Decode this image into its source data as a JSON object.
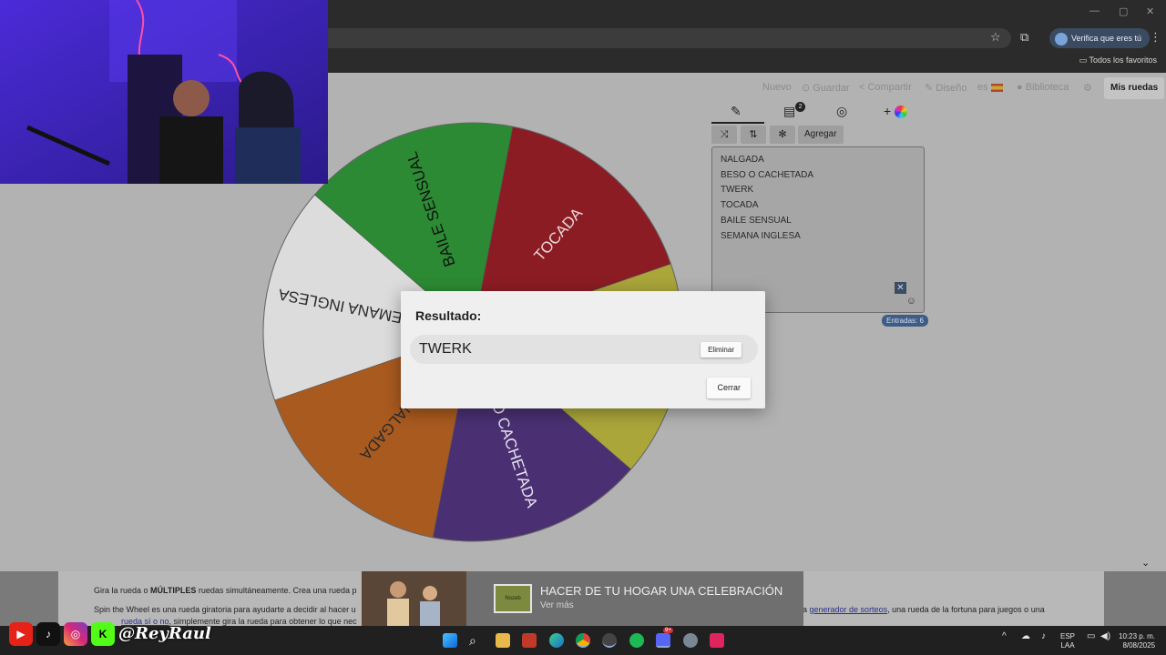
{
  "browser": {
    "verify_label": "Verifica que eres tú",
    "favorites_label": "Todos los favoritos",
    "window_controls": [
      "—",
      "▢",
      "✕"
    ]
  },
  "nav": {
    "items": [
      "Nuevo",
      "Guardar",
      "Compartir",
      "Diseño",
      "es",
      "Biblioteca"
    ],
    "my_wheels": "Mis ruedas"
  },
  "wheel": {
    "segments": [
      {
        "label": "TOCADA",
        "color": "#8b1c24",
        "text_color": "#e8d6d6"
      },
      {
        "label": "TWERK",
        "color": "#aaa63a",
        "text_color": "#2a2a2a"
      },
      {
        "label": "BESO O CACHETADA",
        "visible_text": "O CACHETADA",
        "color": "#4a3072",
        "text_color": "#e9e4f1"
      },
      {
        "label": "NALGADA",
        "color": "#a95a1f",
        "text_color": "#2a2a2a"
      },
      {
        "label": "SEMANA INGLESA",
        "visible_text": "SEMANA INGLESA",
        "color": "#dcdcdc",
        "text_color": "#2a2a2a"
      },
      {
        "label": "BAILE SENSUAL",
        "color": "#2b8a33",
        "text_color": "#111"
      }
    ]
  },
  "editor": {
    "add_label": "Agregar",
    "entries": [
      "NALGADA",
      "BESO O CACHETADA",
      "TWERK",
      "TOCADA",
      "BAILE SENSUAL",
      "SEMANA INGLESA"
    ],
    "entries_count": "Entradas: 6",
    "badge": "2"
  },
  "modal": {
    "title": "Resultado:",
    "result": "TWERK",
    "delete_label": "Eliminar",
    "close_label": "Cerrar"
  },
  "footer": {
    "line1_prefix": "Gira la rueda o ",
    "line1_bold": "MÚLTIPLES",
    "line1_suffix": " ruedas simultáneamente. Crea una rueda p",
    "line2": "Spin the Wheel es una rueda giratoria para ayudarte a decidir al hacer u",
    "line2_right_pre": "na ",
    "line2_right_link": "generador de sorteos",
    "line2_right_post": ", una rueda de la fortuna para juegos o una",
    "line3_pre": "",
    "line3_link": "rueda sí o no",
    "line3_post": ", simplemente gira la rueda para obtener lo que nec"
  },
  "ad": {
    "title": "HACER DE TU HOGAR UNA CELEBRACIÓN",
    "subtitle": "Ver más",
    "logo_text": "Nozeb"
  },
  "taskbar": {
    "lang": "ESP",
    "lang2": "LAA",
    "time": "10:23 p. m.",
    "date": "8/08/2025",
    "discord_badge": "9+"
  },
  "overlay": {
    "handle": "@ReyRaul"
  },
  "colors": {
    "page_bg": "#b2b2b2",
    "modal_bg": "#efefef",
    "accent_badge": "#3f5c86"
  }
}
